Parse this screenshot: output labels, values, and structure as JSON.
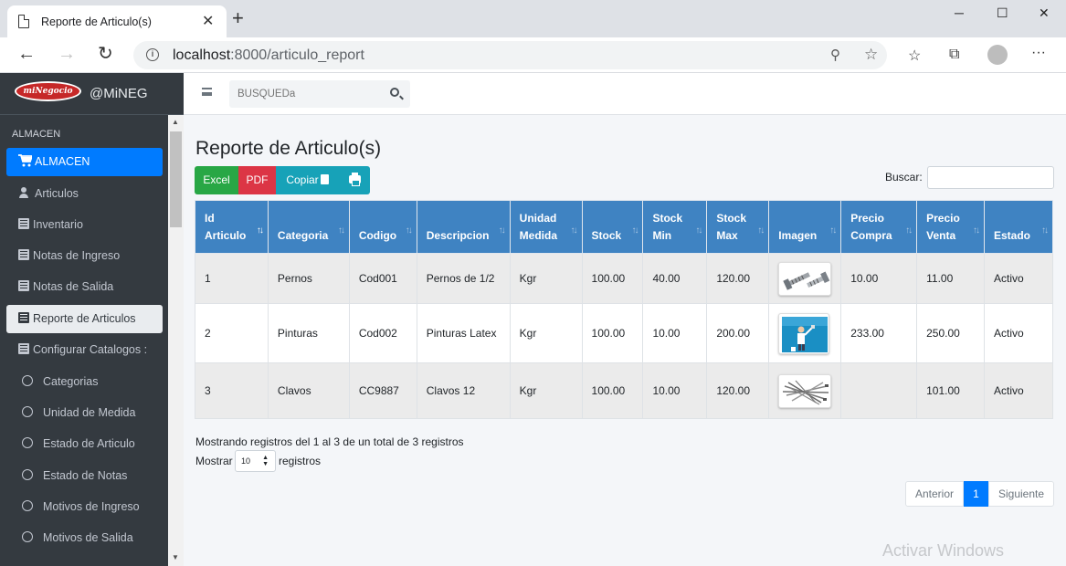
{
  "browser": {
    "tab_title": "Reporte de Articulo(s)",
    "tab_close": "✕",
    "new_tab": "+",
    "url_host": "localhost",
    "url_rest": ":8000/articulo_report",
    "win_minimize": "─",
    "win_maximize": "☐",
    "win_close": "✕",
    "menu_dots": "···"
  },
  "sidebar": {
    "brand_logo": "miNegocio",
    "brand_name": "@MiNEG",
    "section_header": "ALMACEN",
    "items": [
      {
        "label": "ALMACEN",
        "icon": "cart-icon"
      },
      {
        "label": "Articulos",
        "icon": "user-icon"
      },
      {
        "label": "Inventario",
        "icon": "list-icon"
      },
      {
        "label": "Notas de Ingreso",
        "icon": "list-icon"
      },
      {
        "label": "Notas de Salida",
        "icon": "list-icon"
      },
      {
        "label": "Reporte de Articulos",
        "icon": "list-icon"
      },
      {
        "label": "Configurar Catalogos :",
        "icon": "list-icon"
      },
      {
        "label": "Categorias",
        "icon": "circle-icon"
      },
      {
        "label": "Unidad de Medida",
        "icon": "circle-icon"
      },
      {
        "label": "Estado de Articulo",
        "icon": "circle-icon"
      },
      {
        "label": "Estado de Notas",
        "icon": "circle-icon"
      },
      {
        "label": "Motivos de Ingreso",
        "icon": "circle-icon"
      },
      {
        "label": "Motivos de Salida",
        "icon": "circle-icon"
      }
    ]
  },
  "topnav": {
    "search_placeholder": "BUSQUEDa"
  },
  "main": {
    "title": "Reporte de Articulo(s)",
    "buttons": {
      "excel": "Excel",
      "pdf": "PDF",
      "copy": "Copiar"
    },
    "buscar_label": "Buscar:",
    "table": {
      "headers": [
        [
          "Id",
          "Articulo"
        ],
        [
          "",
          "Categoria"
        ],
        [
          "",
          "Codigo"
        ],
        [
          "",
          "Descripcion"
        ],
        [
          "Unidad",
          "Medida"
        ],
        [
          "",
          "Stock"
        ],
        [
          "Stock",
          "Min"
        ],
        [
          "Stock",
          "Max"
        ],
        [
          "",
          "Imagen"
        ],
        [
          "Precio",
          "Compra"
        ],
        [
          "Precio",
          "Venta"
        ],
        [
          "",
          "Estado"
        ]
      ],
      "rows": [
        {
          "id": "1",
          "categoria": "Pernos",
          "codigo": "Cod001",
          "descripcion": "Pernos de 1/2",
          "unidad": "Kgr",
          "stock": "100.00",
          "stock_min": "40.00",
          "stock_max": "120.00",
          "imagen": "bolts-image",
          "precio_compra": "10.00",
          "precio_venta": "11.00",
          "estado": "Activo"
        },
        {
          "id": "2",
          "categoria": "Pinturas",
          "codigo": "Cod002",
          "descripcion": "Pinturas Latex",
          "unidad": "Kgr",
          "stock": "100.00",
          "stock_min": "10.00",
          "stock_max": "200.00",
          "imagen": "painter-image",
          "precio_compra": "233.00",
          "precio_venta": "250.00",
          "estado": "Activo"
        },
        {
          "id": "3",
          "categoria": "Clavos",
          "codigo": "CC9887",
          "descripcion": "Clavos 12",
          "unidad": "Kgr",
          "stock": "100.00",
          "stock_min": "10.00",
          "stock_max": "120.00",
          "imagen": "nails-image",
          "precio_compra": "",
          "precio_venta": "101.00",
          "estado": "Activo"
        }
      ]
    },
    "info": "Mostrando registros del 1 al 3 de un total de 3 registros",
    "mostrar": "Mostrar",
    "length_value": "10",
    "registros": "registros",
    "pagination": {
      "prev": "Anterior",
      "current": "1",
      "next": "Siguiente"
    }
  },
  "watermark": "Activar Windows",
  "colors": {
    "sidebar_bg": "#343a40",
    "active_blue": "#007bff",
    "table_header": "#3f83c2",
    "excel": "#28a745",
    "pdf": "#dc3545",
    "info": "#17a2b8"
  }
}
